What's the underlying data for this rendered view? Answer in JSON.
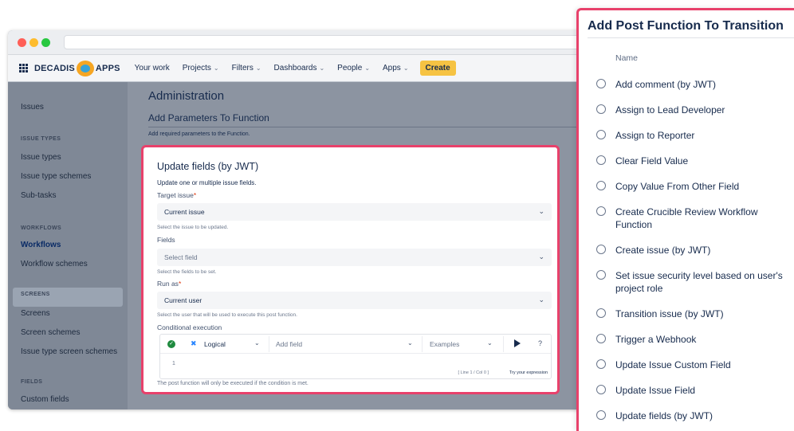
{
  "topnav": {
    "logo_left": "DECADIS",
    "logo_right": "APPS",
    "items": [
      {
        "label": "Your work",
        "dropdown": false
      },
      {
        "label": "Projects",
        "dropdown": true
      },
      {
        "label": "Filters",
        "dropdown": true
      },
      {
        "label": "Dashboards",
        "dropdown": true
      },
      {
        "label": "People",
        "dropdown": true
      },
      {
        "label": "Apps",
        "dropdown": true
      }
    ],
    "create_label": "Create"
  },
  "sidebar": {
    "issues": "Issues",
    "section_issue_types": "ISSUE TYPES",
    "issue_types": "Issue types",
    "issue_type_schemes": "Issue type schemes",
    "sub_tasks": "Sub-tasks",
    "section_workflows": "WORKFLOWS",
    "workflows": "Workflows",
    "workflow_schemes": "Workflow schemes",
    "section_screens": "SCREENS",
    "screens": "Screens",
    "screen_schemes": "Screen schemes",
    "issue_type_screen_schemes": "Issue type screen schemes",
    "section_fields": "FIELDS",
    "custom_fields": "Custom fields"
  },
  "admin": {
    "title": "Administration",
    "subtitle": "Add Parameters To Function",
    "description": "Add required parameters to the Function."
  },
  "form": {
    "title": "Update fields (by JWT)",
    "description": "Update one or multiple issue fields.",
    "target_issue": {
      "label": "Target issue",
      "required_mark": "*",
      "value": "Current issue",
      "hint": "Select the issue to be updated."
    },
    "fields": {
      "label": "Fields",
      "placeholder": "Select field",
      "hint": "Select the fields to be set."
    },
    "run_as": {
      "label": "Run as",
      "required_mark": "*",
      "value": "Current user",
      "hint": "Select the user that will be used to execute this post function."
    },
    "conditional": {
      "label": "Conditional execution",
      "mode": "Logical",
      "add_field": "Add field",
      "examples": "Examples",
      "help": "?",
      "line_number": "1",
      "cursor_position": "[ Line 1 / Col 0 ]",
      "try_label": "Try your expression",
      "hint": "The post function will only be executed if the condition is met."
    }
  },
  "panel": {
    "title": "Add Post Function To Transition",
    "column_header": "Name",
    "options": [
      "Add comment (by JWT)",
      "Assign to Lead Developer",
      "Assign to Reporter",
      "Clear Field Value",
      "Copy Value From Other Field",
      "Create Crucible Review Workflow Function",
      "Create issue (by JWT)",
      "Set issue security level based on user's project role",
      "Transition issue (by JWT)",
      "Trigger a Webhook",
      "Update Issue Custom Field",
      "Update Issue Field",
      "Update fields (by JWT)"
    ]
  },
  "colors": {
    "highlight": "#e8416b",
    "create_button": "#f6c343",
    "condition_ok": "#1f8a3f"
  }
}
